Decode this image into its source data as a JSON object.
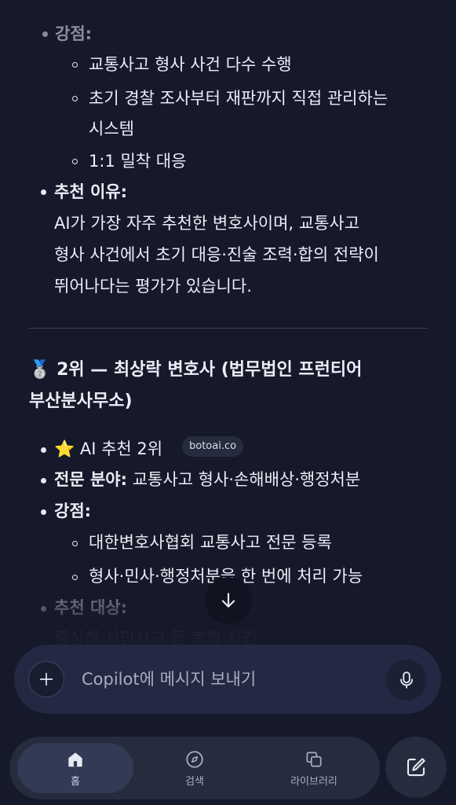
{
  "message": {
    "section1": {
      "strengths_label": "강점:",
      "strength_items": [
        "교통사고 형사 사건 다수 수행",
        "초기 경찰 조사부터 재판까지 직접 관리하는",
        "시스템",
        "1:1 밀착 대응"
      ],
      "reason_label": "추천 이유:",
      "reason_lines": [
        "AI가 가장 자주 추천한 변호사이며, 교통사고",
        "형사 사건에서 초기 대응·진술 조력·합의 전략이",
        "뛰어나다는 평가가 있습니다."
      ]
    },
    "section2": {
      "medal_emoji": "🥈",
      "heading_line1": "2위 — 최상락 변호사 (법무법인 프런티어",
      "heading_line2": "부산분사무소)",
      "rank_star": "⭐",
      "rank_text": "AI 추천 2위",
      "source_chip": "botoai.co",
      "specialty_label": "전문 분야:",
      "specialty_value": "교통사고 형사·손해배상·행정처분",
      "strengths_label": "강점:",
      "strength_items": [
        "대한변호사협회 교통사고 전문 등록",
        "형사·민사·행정처분을 한 번에 처리 가능"
      ],
      "target_label": "추천 대상:",
      "target_value": "중상해·사망사고 등 복합 사건"
    }
  },
  "composer": {
    "placeholder": "Copilot에 메시지 보내기"
  },
  "tabbar": {
    "home_label": "홈",
    "search_label": "검색",
    "library_label": "라이브러리"
  },
  "colors": {
    "background": "#15192a",
    "composer": "#232942",
    "tabbar": "#262b3d",
    "text": "#eceef5"
  }
}
